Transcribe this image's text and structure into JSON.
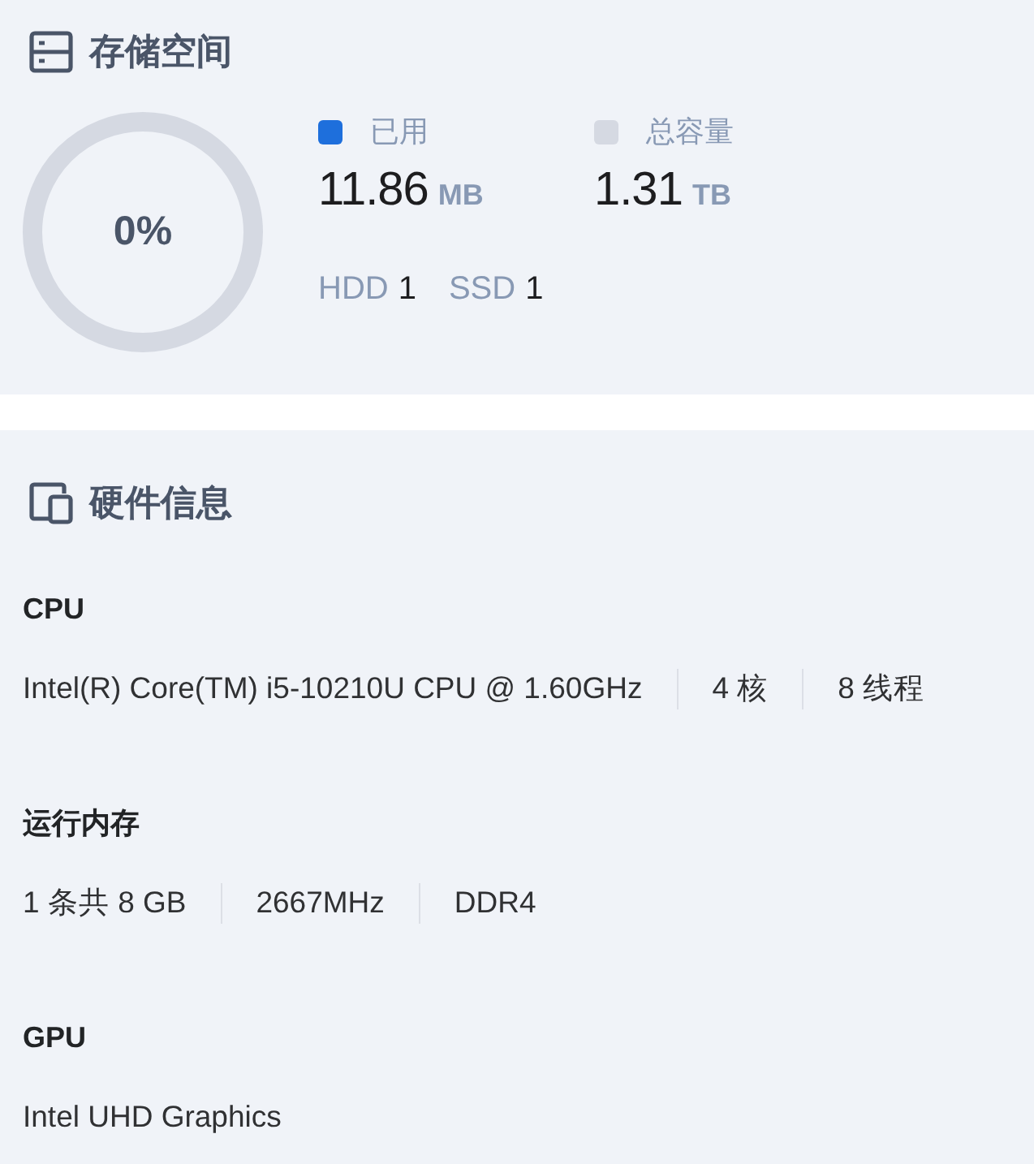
{
  "storage": {
    "title": "存储空间",
    "ring": {
      "label": "0%",
      "level": 0
    },
    "legend": [
      {
        "label": "已用",
        "color": "#1e6fdc",
        "value": "11.86",
        "unit": "MB"
      },
      {
        "label": "总容量",
        "color": "#d5d9e2",
        "value": "1.31",
        "unit": "TB"
      }
    ],
    "disks": [
      {
        "type": "HDD",
        "count": "1"
      },
      {
        "type": "SSD",
        "count": "1"
      }
    ]
  },
  "hardware": {
    "title": "硬件信息",
    "sections": [
      {
        "title": "CPU",
        "details": [
          "Intel(R) Core(TM) i5-10210U CPU @ 1.60GHz",
          "4 核",
          "8 线程"
        ]
      },
      {
        "title": "运行内存",
        "details": [
          "1 条共 8 GB",
          "2667MHz",
          "DDR4"
        ]
      },
      {
        "title": "GPU",
        "details": [
          "Intel UHD Graphics"
        ]
      }
    ]
  }
}
